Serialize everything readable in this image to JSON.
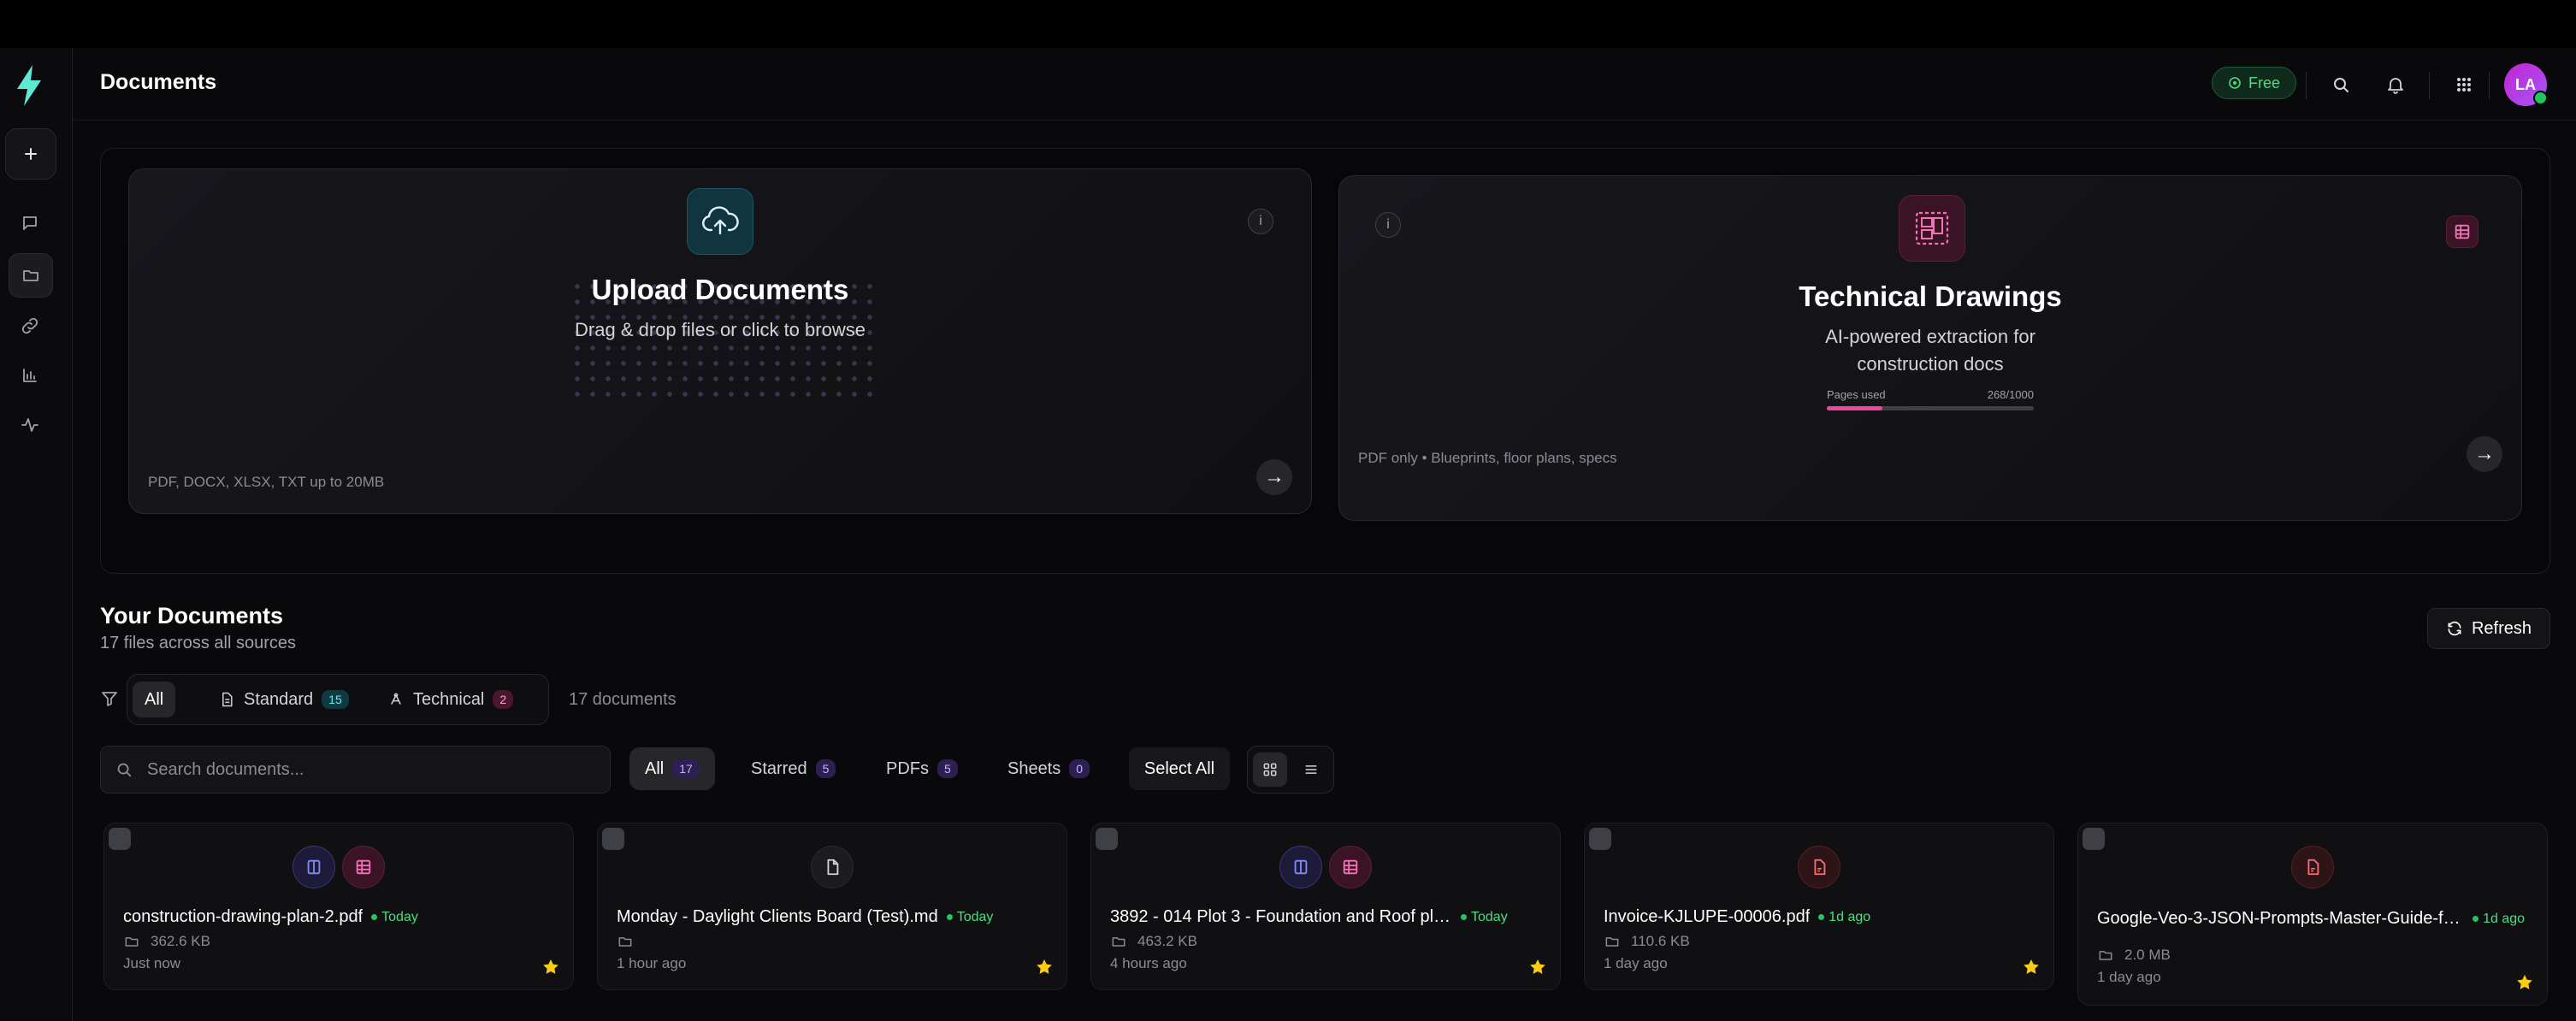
{
  "header": {
    "title": "Documents",
    "plan_badge": "Free",
    "avatar_initials": "LA"
  },
  "rail": {
    "items": [
      "new",
      "chat",
      "documents",
      "links",
      "analytics",
      "activity"
    ],
    "active": "documents"
  },
  "upload_card": {
    "title": "Upload Documents",
    "description": "Drag & drop files or click to browse",
    "info": "i",
    "footer": "PDF, DOCX, XLSX, TXT up to 20MB",
    "arrow": "→"
  },
  "tech_card": {
    "title": "Technical Drawings",
    "description": "AI-powered extraction for construction docs",
    "info": "i",
    "footer": "PDF only • Blueprints, floor plans, specs",
    "arrow": "→",
    "quota_label": "Pages used",
    "quota_value": "268/1000",
    "quota_fraction": 0.268,
    "accent": "#ec4899"
  },
  "section": {
    "title": "Your Documents",
    "subtitle": "17 files across all sources",
    "refresh_label": "Refresh"
  },
  "source_filter": {
    "all": "All",
    "standard": "Standard",
    "standard_count": "15",
    "technical": "Technical",
    "technical_count": "2",
    "doc_count": "17 documents"
  },
  "search": {
    "placeholder": "Search documents..."
  },
  "type_filter": {
    "all": "All",
    "all_count": "17",
    "starred": "Starred",
    "starred_count": "5",
    "pdfs": "PDFs",
    "pdfs_count": "5",
    "sheets": "Sheets",
    "sheets_count": "0",
    "select_all": "Select All"
  },
  "documents": [
    {
      "name": "construction-drawing-plan-2.pdf",
      "when": "Today",
      "size": "362.6 KB",
      "ago": "Just now",
      "icons": [
        "drawing-icon",
        "table-icon"
      ],
      "starred": true
    },
    {
      "name": "Monday - Daylight Clients Board (Test).md",
      "when": "Today",
      "size": "",
      "ago": "1 hour ago",
      "icons": [
        "file-icon"
      ],
      "starred": true
    },
    {
      "name": "3892 - 014 Plot 3 - Foundation and Roof plans...",
      "when": "Today",
      "size": "463.2 KB",
      "ago": "4 hours ago",
      "icons": [
        "drawing-icon",
        "table-icon"
      ],
      "starred": true
    },
    {
      "name": "Invoice-KJLUPE-00006.pdf",
      "when": "1d ago",
      "size": "110.6 KB",
      "ago": "1 day ago",
      "icons": [
        "pdf-icon"
      ],
      "starred": true
    },
    {
      "name": "Google-Veo-3-JSON-Prompts-Master-Guide-fo...",
      "when": "1d ago",
      "size": "2.0 MB",
      "ago": "1 day ago",
      "icons": [
        "pdf-icon"
      ],
      "starred": true
    }
  ]
}
